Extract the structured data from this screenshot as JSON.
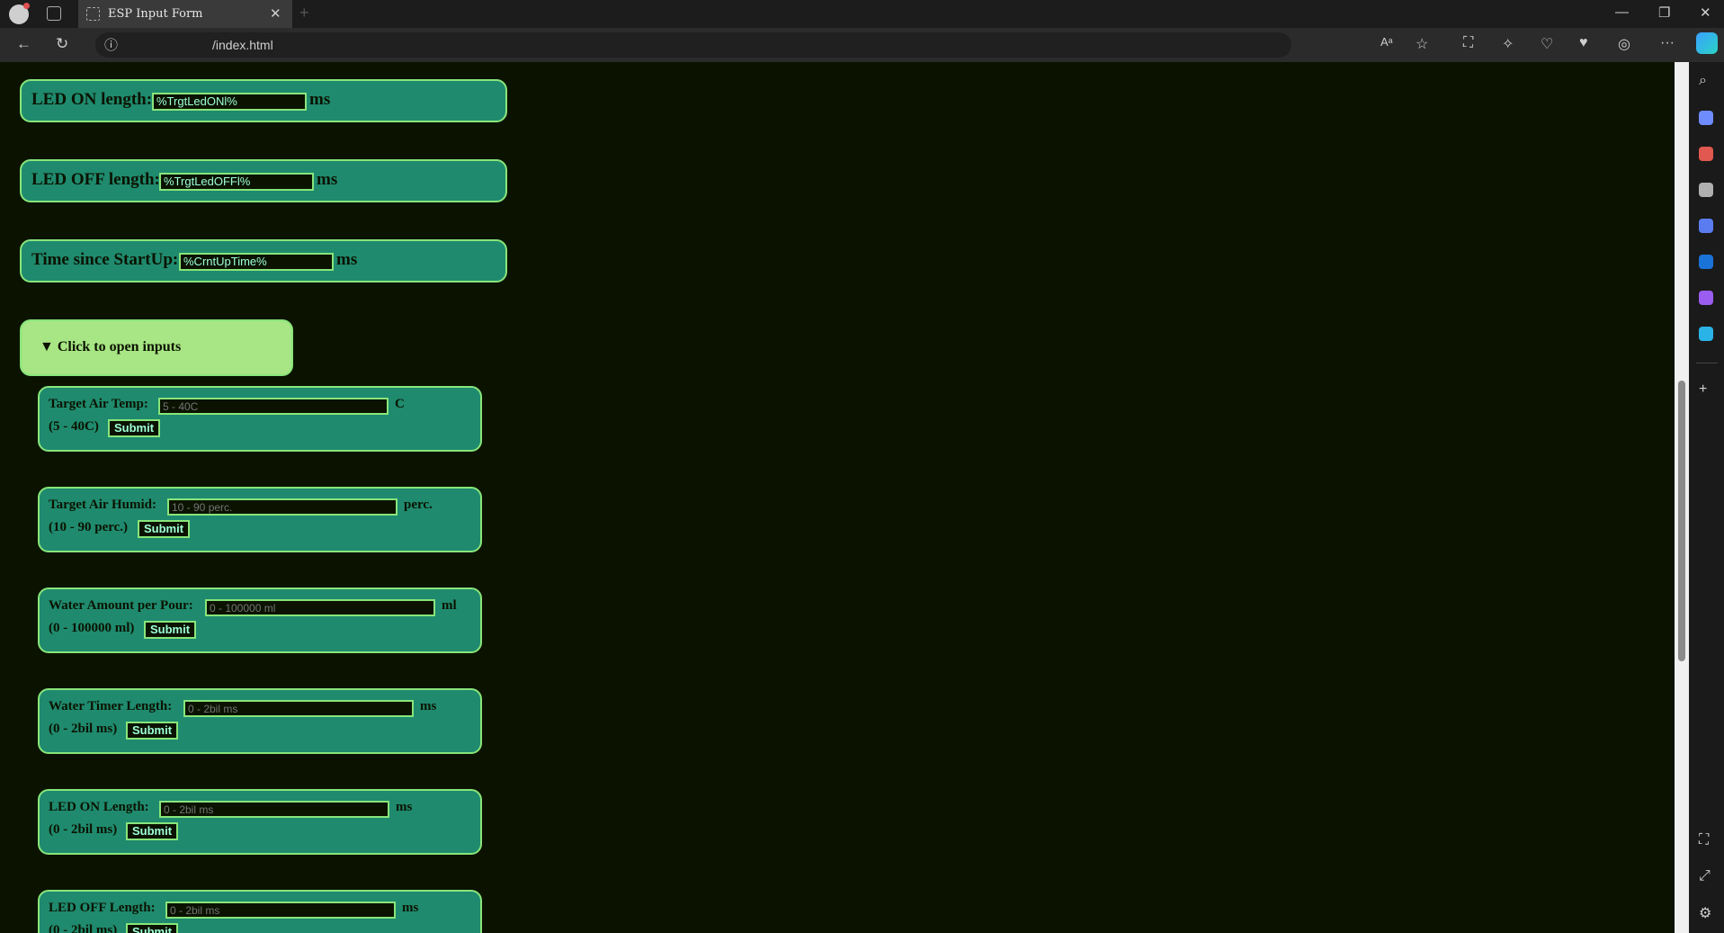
{
  "browser": {
    "tab_title": "ESP Input Form",
    "url": "/index.html",
    "tab_close": "✕",
    "new_tab": "+"
  },
  "status": [
    {
      "label": "LED ON length:",
      "value": "%TrgtLedONl%",
      "unit": "ms"
    },
    {
      "label": "LED OFF length:",
      "value": "%TrgtLedOFFl%",
      "unit": "ms"
    },
    {
      "label": "Time since StartUp:",
      "value": "%CrntUpTime%",
      "unit": "ms"
    }
  ],
  "details": {
    "summary": "▼ Click to open inputs"
  },
  "forms": [
    {
      "label": "Target Air Temp:",
      "placeholder": "5 - 40C",
      "unit": "C",
      "range": "(5 - 40C)",
      "submit": "Submit"
    },
    {
      "label": "Target Air Humid:",
      "placeholder": "10 - 90 perc.",
      "unit": "perc.",
      "range": "(10 - 90 perc.)",
      "submit": "Submit"
    },
    {
      "label": "Water Amount per Pour:",
      "placeholder": "0 - 100000 ml",
      "unit": "ml",
      "range": "(0 - 100000 ml)",
      "submit": "Submit"
    },
    {
      "label": "Water Timer Length:",
      "placeholder": "0 - 2bil ms",
      "unit": "ms",
      "range": "(0 - 2bil ms)",
      "submit": "Submit"
    },
    {
      "label": "LED ON Length:",
      "placeholder": "0 - 2bil ms",
      "unit": "ms",
      "range": "(0 - 2bil ms)",
      "submit": "Submit"
    },
    {
      "label": "LED OFF Length:",
      "placeholder": "0 - 2bil ms",
      "unit": "ms",
      "range": "(0 - 2bil ms)",
      "submit": "Submit"
    }
  ]
}
